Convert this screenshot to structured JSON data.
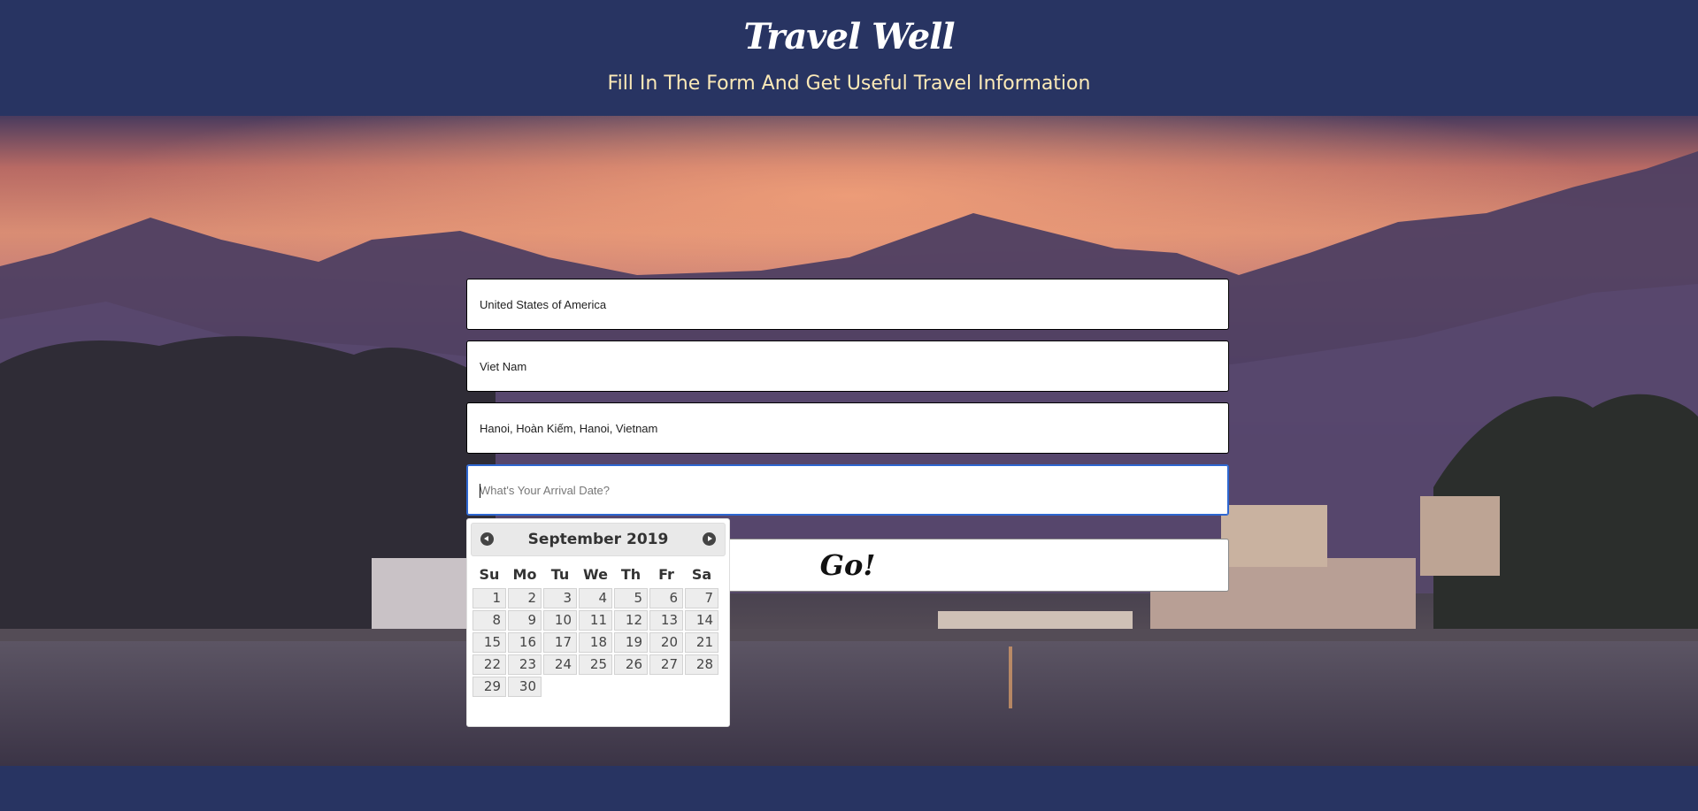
{
  "header": {
    "brand": "Travel Well",
    "tagline": "Fill In The Form And Get Useful Travel Information"
  },
  "form": {
    "origin_value": "United States of America",
    "destination_value": "Viet Nam",
    "city_value": "Hanoi, Hoàn Kiếm, Hanoi, Vietnam",
    "arrival_placeholder": "What's Your Arrival Date?",
    "go_label": "Go!"
  },
  "datepicker": {
    "month_label": "September 2019",
    "weekdays": [
      "Su",
      "Mo",
      "Tu",
      "We",
      "Th",
      "Fr",
      "Sa"
    ],
    "weeks": [
      [
        "",
        "1",
        "2",
        "3",
        "4",
        "5",
        "6",
        "7"
      ],
      [
        "8",
        "9",
        "10",
        "11",
        "12",
        "13",
        "14"
      ],
      [
        "15",
        "16",
        "17",
        "18",
        "19",
        "20",
        "21"
      ],
      [
        "22",
        "23",
        "24",
        "25",
        "26",
        "27",
        "28"
      ],
      [
        "29",
        "30"
      ]
    ]
  },
  "colors": {
    "header_bg": "#283462",
    "tagline": "#fbe9b7",
    "focus_border": "#2e67d1"
  }
}
